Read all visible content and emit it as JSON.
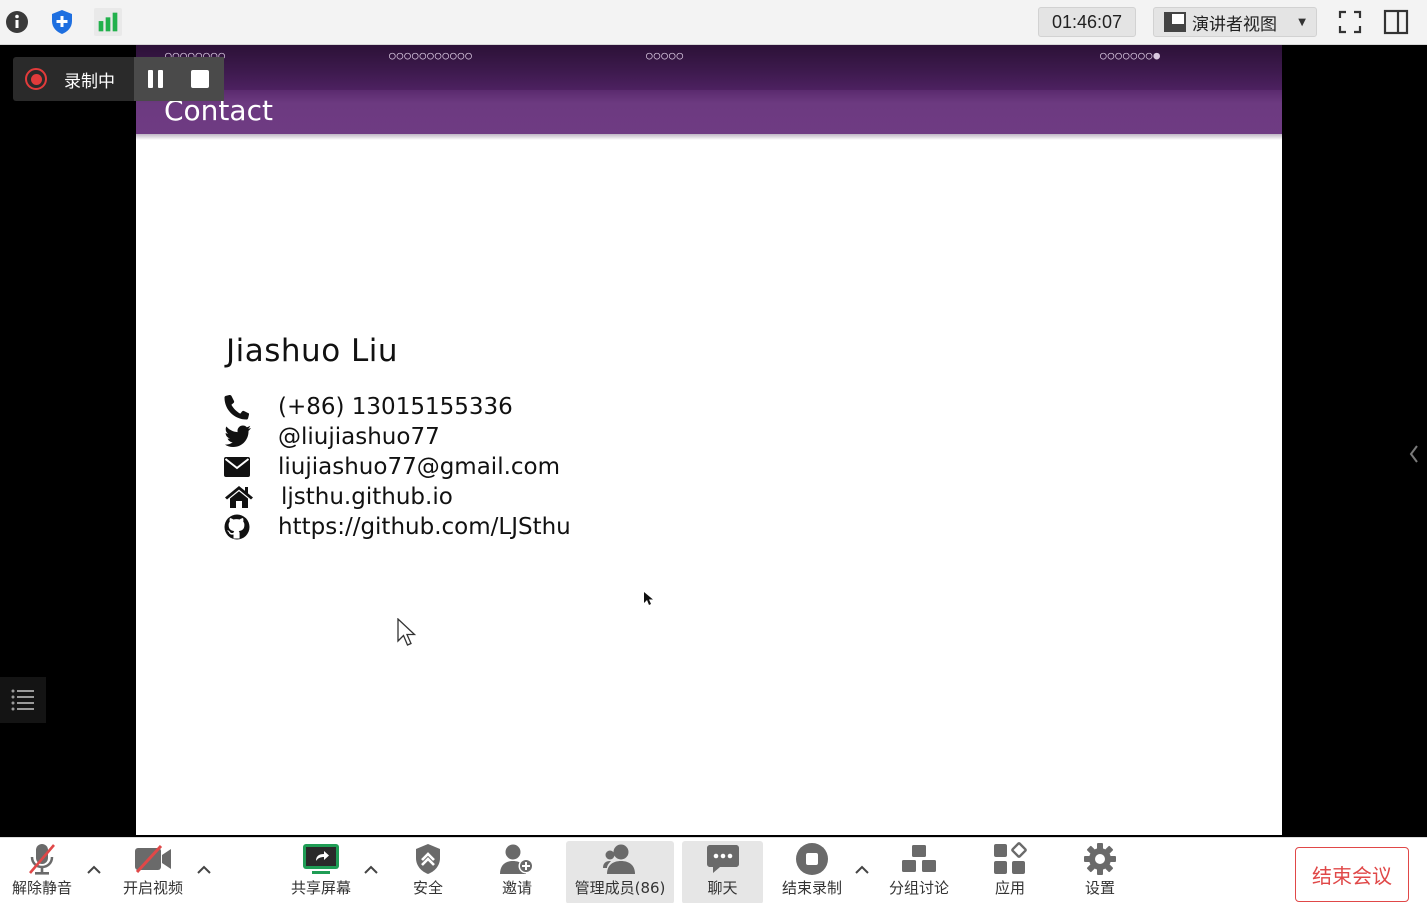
{
  "topbar": {
    "timer": "01:46:07",
    "presenter_view_label": "演讲者视图"
  },
  "recording": {
    "label": "录制中"
  },
  "slide": {
    "nav_groups": [
      "○○○○○○○○",
      "○○○○○○○○○○○",
      "○○○○○",
      "○○○○○○○●"
    ],
    "title": "Contact",
    "name": "Jiashuo Liu",
    "contacts": [
      {
        "icon": "phone-icon",
        "text": "(+86) 13015155336"
      },
      {
        "icon": "twitter-icon",
        "text": "@liujiashuo77"
      },
      {
        "icon": "envelope-icon",
        "text": "liujiashuo77@gmail.com"
      },
      {
        "icon": "home-icon",
        "text": "ljsthu.github.io"
      },
      {
        "icon": "github-icon",
        "text": "https://github.com/LJSthu"
      }
    ]
  },
  "toolbar": {
    "unmute": "解除静音",
    "start_video": "开启视频",
    "share_screen": "共享屏幕",
    "security": "安全",
    "invite": "邀请",
    "participants": "管理成员(86)",
    "chat": "聊天",
    "stop_recording": "结束录制",
    "breakout": "分组讨论",
    "apps": "应用",
    "settings": "设置",
    "end_meeting": "结束会议"
  },
  "colors": {
    "slide_header": "#6f3b83",
    "slide_nav_bar": "#3e1a4e",
    "record_red": "#e23b3b",
    "end_red": "#e04848",
    "share_green": "#1f9d55",
    "stats_green": "#22b14c",
    "shield_blue": "#1e6fe0"
  }
}
